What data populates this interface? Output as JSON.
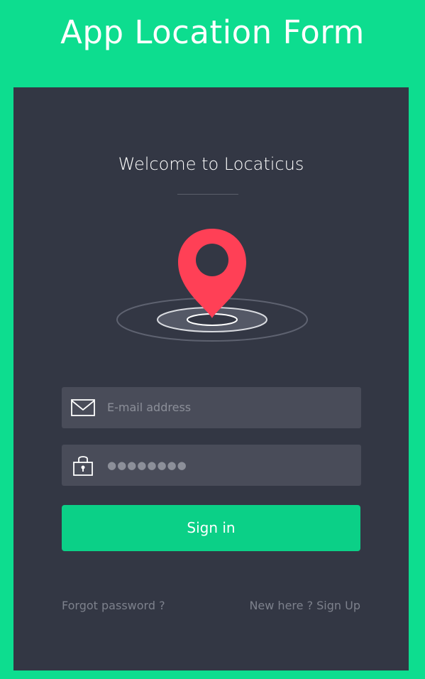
{
  "page": {
    "title": "App Location Form"
  },
  "form": {
    "welcome": "Welcome to Locaticus",
    "email_placeholder": "E-mail address",
    "password_mask": "●●●●●●●●",
    "signin_label": "Sign in",
    "forgot_label": "Forgot password ?",
    "signup_label": "New here ? Sign Up"
  },
  "icons": {
    "email": "mail-icon",
    "password": "lock-icon",
    "logo": "location-pin-icon"
  },
  "colors": {
    "background": "#0ddd8f",
    "panel": "#333744",
    "field": "#494c59",
    "button": "#0bd087",
    "pin": "#ff4056",
    "text_muted": "#8c8f99"
  }
}
